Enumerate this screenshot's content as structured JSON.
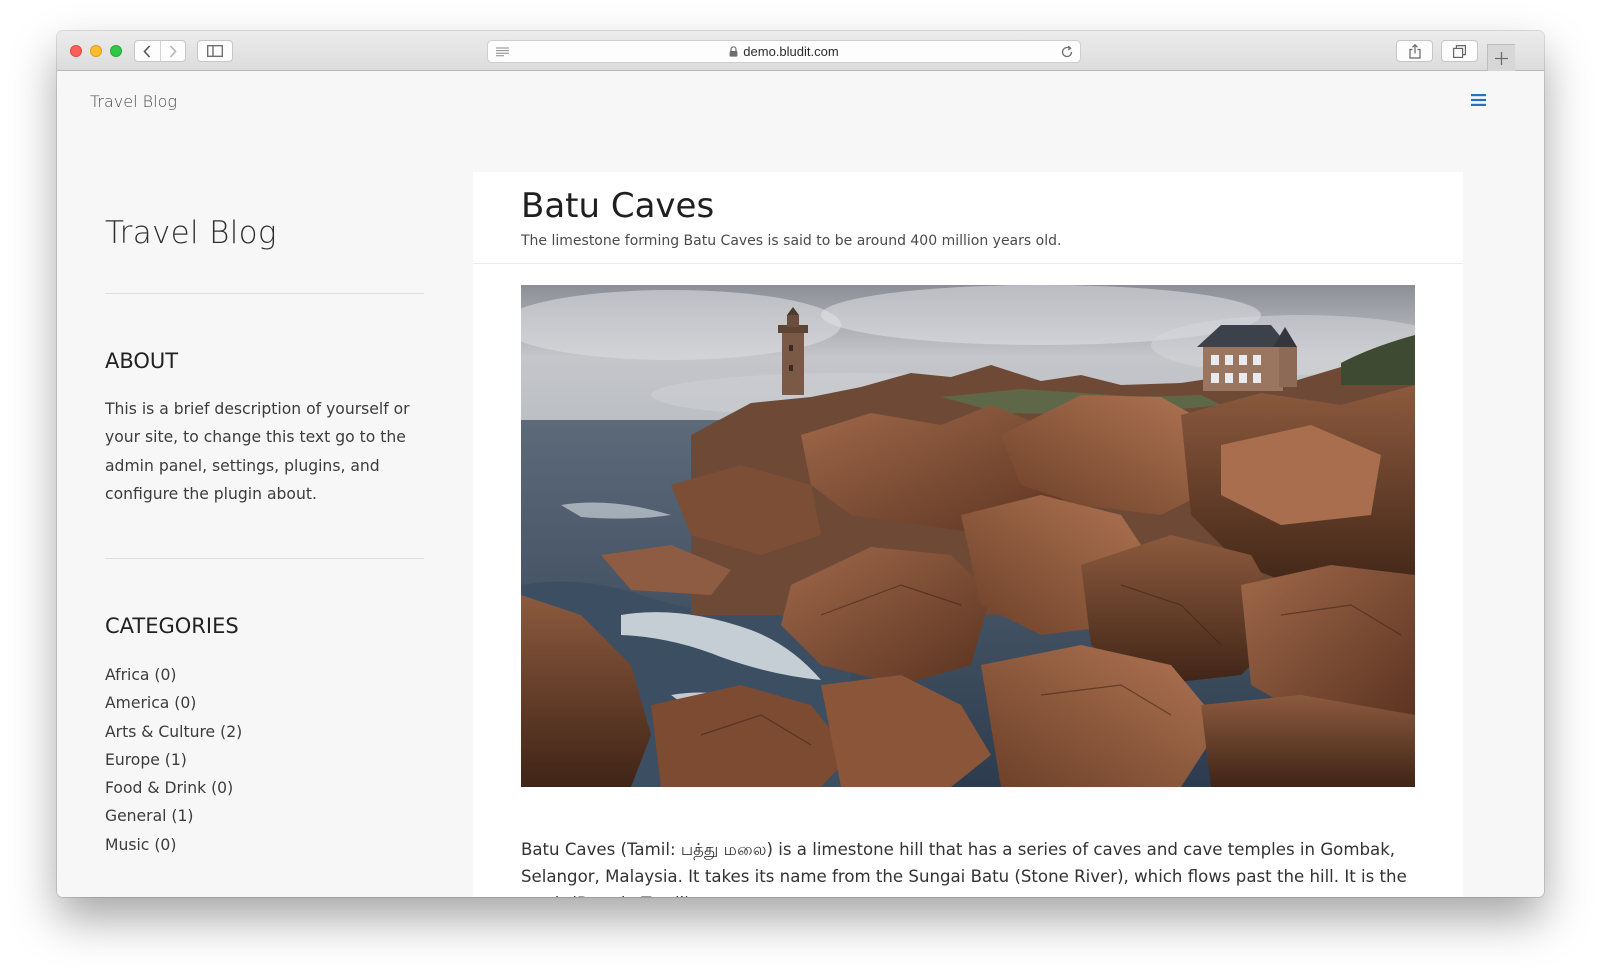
{
  "browser": {
    "url": "demo.bludit.com"
  },
  "header": {
    "brand": "Travel Blog"
  },
  "sidebar": {
    "title": "Travel Blog",
    "about": {
      "heading": "ABOUT",
      "text": "This is a brief description of yourself or your site, to change this text go to the admin panel, settings, plugins, and configure the plugin about."
    },
    "categories": {
      "heading": "CATEGORIES",
      "items": [
        "Africa (0)",
        "America (0)",
        "Arts & Culture (2)",
        "Europe (1)",
        "Food & Drink (0)",
        "General (1)",
        "Music (0)"
      ]
    }
  },
  "article": {
    "title": "Batu Caves",
    "subtitle": "The limestone forming Batu Caves is said to be around 400 million years old.",
    "body": "Batu Caves (Tamil: பத்து மலை) is a limestone hill that has a series of caves and cave temples in Gombak, Selangor, Malaysia. It takes its name from the Sungai Batu (Stone River), which flows past the hill. It is the tenth (Batu in Tamil)"
  },
  "colors": {
    "accent": "#2672c2",
    "page_bg": "#f7f7f7",
    "card_bg": "#ffffff"
  }
}
